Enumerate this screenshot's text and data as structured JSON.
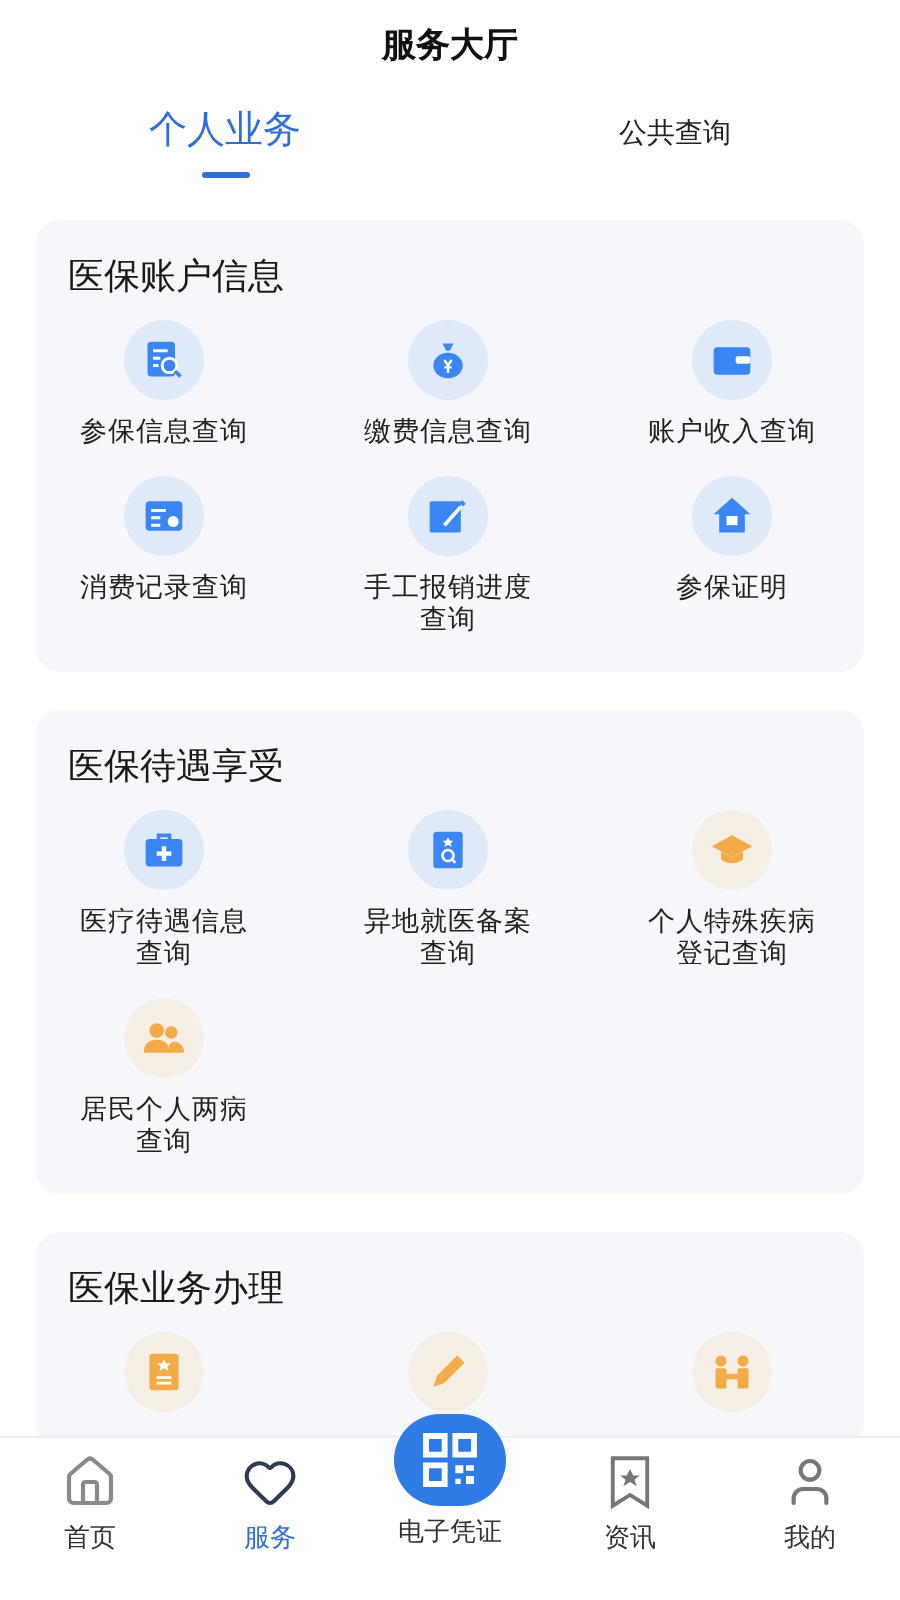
{
  "header": {
    "title": "服务大厅"
  },
  "tabs": [
    {
      "label": "个人业务",
      "selected": true
    },
    {
      "label": "公共查询",
      "selected": false
    }
  ],
  "sections": [
    {
      "title": "医保账户信息",
      "items": [
        {
          "label": "参保信息查询",
          "color": "#3b86f5"
        },
        {
          "label": "缴费信息查询",
          "color": "#3b86f5"
        },
        {
          "label": "账户收入查询",
          "color": "#3b86f5"
        },
        {
          "label": "消费记录查询",
          "color": "#3b86f5"
        },
        {
          "label": "手工报销进度查询",
          "color": "#3b86f5"
        },
        {
          "label": "参保证明",
          "color": "#3b86f5"
        }
      ]
    },
    {
      "title": "医保待遇享受",
      "items": [
        {
          "label": "医疗待遇信息查询",
          "color": "#3b86f5"
        },
        {
          "label": "异地就医备案查询",
          "color": "#3b86f5"
        },
        {
          "label": "个人特殊疾病登记查询",
          "color": "#f3ac45"
        },
        {
          "label": "居民个人两病查询",
          "color": "#f3ac45"
        }
      ]
    },
    {
      "title": "医保业务办理",
      "items": [
        {
          "color": "#f3ac45"
        },
        {
          "color": "#f3ac45"
        },
        {
          "color": "#f3ac45"
        }
      ]
    }
  ],
  "nav": [
    {
      "label": "首页",
      "kind": "tab",
      "selected": false
    },
    {
      "label": "服务",
      "kind": "tab",
      "selected": true
    },
    {
      "label": "电子凭证",
      "kind": "scan",
      "selected": false
    },
    {
      "label": "资讯",
      "kind": "tab",
      "selected": false
    },
    {
      "label": "我的",
      "kind": "tab",
      "selected": false
    }
  ]
}
